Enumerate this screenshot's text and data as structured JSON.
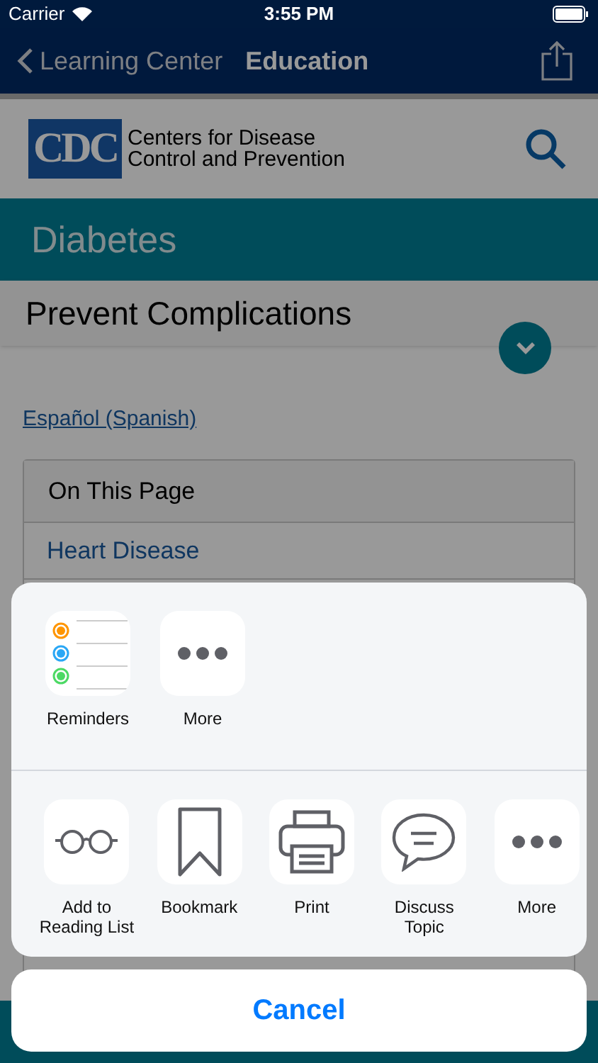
{
  "status_bar": {
    "carrier": "Carrier",
    "time": "3:55 PM"
  },
  "nav": {
    "back": "Learning Center",
    "title": "Education"
  },
  "header": {
    "logo": "CDC",
    "org_line_1": "Centers for Disease",
    "org_line_2": "Control and Prevention"
  },
  "topic": "Diabetes",
  "page_title": "Prevent Complications",
  "language_link": "Español (Spanish)",
  "on_this_page": {
    "title": "On This Page",
    "links": [
      "Heart Disease"
    ]
  },
  "share_sheet": {
    "apps": [
      {
        "kind": "reminders",
        "label": "Reminders"
      },
      {
        "kind": "more",
        "label": "More"
      }
    ],
    "actions": [
      {
        "kind": "reading-list",
        "label": "Add to Reading List"
      },
      {
        "kind": "bookmark",
        "label": "Bookmark"
      },
      {
        "kind": "print",
        "label": "Print"
      },
      {
        "kind": "discuss",
        "label": "Discuss Topic"
      },
      {
        "kind": "more",
        "label": "More"
      }
    ],
    "cancel": "Cancel"
  }
}
